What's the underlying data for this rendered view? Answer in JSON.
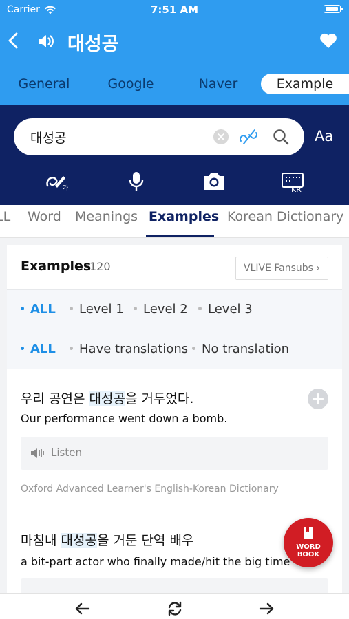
{
  "status": {
    "carrier": "Carrier",
    "time": "7:51 AM"
  },
  "header": {
    "title": "대성공",
    "tabs": [
      "General",
      "Google",
      "Naver",
      "Example"
    ],
    "active_tab": "Example"
  },
  "search": {
    "value": "대성공",
    "font_toggle_label": "Aa",
    "tools": [
      "handwriting-icon",
      "microphone-icon",
      "camera-icon",
      "korean-keyboard-icon"
    ],
    "keyboard_badge": "KR",
    "handwriting_badge": "가"
  },
  "subtabs": {
    "items": [
      "LL",
      "Word",
      "Meanings",
      "Examples",
      "Korean Dictionary"
    ],
    "active": "Examples"
  },
  "examples": {
    "title": "Examples",
    "count": "120",
    "fansubs_label": "VLIVE Fansubs ›",
    "level_filters": [
      "ALL",
      "Level 1",
      "Level 2",
      "Level 3"
    ],
    "translation_filters": [
      "ALL",
      "Have translations",
      "No translation"
    ],
    "entries": [
      {
        "ko_before": "우리 공연은 ",
        "ko_highlight": "대성공",
        "ko_after": "을 거두었다.",
        "en": "Our performance went down a bomb.",
        "listen_label": "Listen",
        "source": "Oxford Advanced Learner's English-Korean Dictionary"
      },
      {
        "ko_before": "마침내 ",
        "ko_highlight": "대성공",
        "ko_after": "을 거둔 단역 배우",
        "en": "a bit-part actor who finally made/hit the big time"
      }
    ]
  },
  "word_book": {
    "line1": "WORD",
    "line2": "BOOK"
  },
  "colors": {
    "primary_blue": "#2f9cf0",
    "navy": "#0f2263",
    "accent_red": "#d11d24",
    "active_filter": "#1e8fe6"
  }
}
